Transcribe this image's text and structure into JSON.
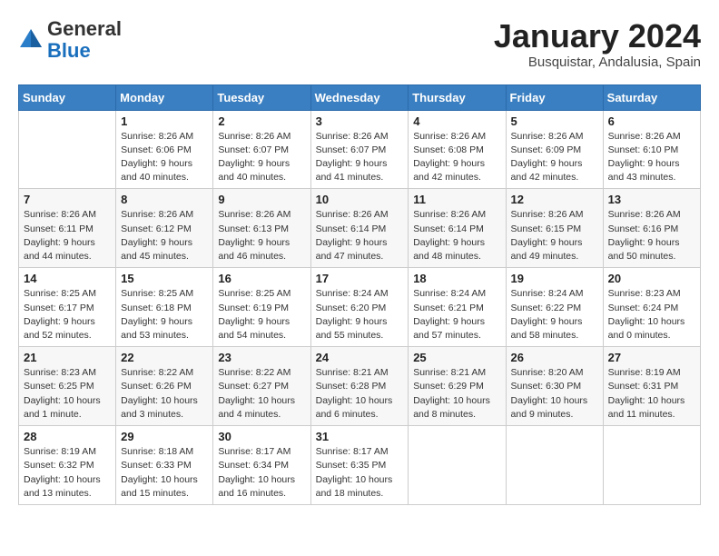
{
  "logo": {
    "general": "General",
    "blue": "Blue"
  },
  "title": "January 2024",
  "subtitle": "Busquistar, Andalusia, Spain",
  "days_of_week": [
    "Sunday",
    "Monday",
    "Tuesday",
    "Wednesday",
    "Thursday",
    "Friday",
    "Saturday"
  ],
  "weeks": [
    [
      {
        "day": "",
        "info": ""
      },
      {
        "day": "1",
        "info": "Sunrise: 8:26 AM\nSunset: 6:06 PM\nDaylight: 9 hours\nand 40 minutes."
      },
      {
        "day": "2",
        "info": "Sunrise: 8:26 AM\nSunset: 6:07 PM\nDaylight: 9 hours\nand 40 minutes."
      },
      {
        "day": "3",
        "info": "Sunrise: 8:26 AM\nSunset: 6:07 PM\nDaylight: 9 hours\nand 41 minutes."
      },
      {
        "day": "4",
        "info": "Sunrise: 8:26 AM\nSunset: 6:08 PM\nDaylight: 9 hours\nand 42 minutes."
      },
      {
        "day": "5",
        "info": "Sunrise: 8:26 AM\nSunset: 6:09 PM\nDaylight: 9 hours\nand 42 minutes."
      },
      {
        "day": "6",
        "info": "Sunrise: 8:26 AM\nSunset: 6:10 PM\nDaylight: 9 hours\nand 43 minutes."
      }
    ],
    [
      {
        "day": "7",
        "info": "Sunrise: 8:26 AM\nSunset: 6:11 PM\nDaylight: 9 hours\nand 44 minutes."
      },
      {
        "day": "8",
        "info": "Sunrise: 8:26 AM\nSunset: 6:12 PM\nDaylight: 9 hours\nand 45 minutes."
      },
      {
        "day": "9",
        "info": "Sunrise: 8:26 AM\nSunset: 6:13 PM\nDaylight: 9 hours\nand 46 minutes."
      },
      {
        "day": "10",
        "info": "Sunrise: 8:26 AM\nSunset: 6:14 PM\nDaylight: 9 hours\nand 47 minutes."
      },
      {
        "day": "11",
        "info": "Sunrise: 8:26 AM\nSunset: 6:14 PM\nDaylight: 9 hours\nand 48 minutes."
      },
      {
        "day": "12",
        "info": "Sunrise: 8:26 AM\nSunset: 6:15 PM\nDaylight: 9 hours\nand 49 minutes."
      },
      {
        "day": "13",
        "info": "Sunrise: 8:26 AM\nSunset: 6:16 PM\nDaylight: 9 hours\nand 50 minutes."
      }
    ],
    [
      {
        "day": "14",
        "info": "Sunrise: 8:25 AM\nSunset: 6:17 PM\nDaylight: 9 hours\nand 52 minutes."
      },
      {
        "day": "15",
        "info": "Sunrise: 8:25 AM\nSunset: 6:18 PM\nDaylight: 9 hours\nand 53 minutes."
      },
      {
        "day": "16",
        "info": "Sunrise: 8:25 AM\nSunset: 6:19 PM\nDaylight: 9 hours\nand 54 minutes."
      },
      {
        "day": "17",
        "info": "Sunrise: 8:24 AM\nSunset: 6:20 PM\nDaylight: 9 hours\nand 55 minutes."
      },
      {
        "day": "18",
        "info": "Sunrise: 8:24 AM\nSunset: 6:21 PM\nDaylight: 9 hours\nand 57 minutes."
      },
      {
        "day": "19",
        "info": "Sunrise: 8:24 AM\nSunset: 6:22 PM\nDaylight: 9 hours\nand 58 minutes."
      },
      {
        "day": "20",
        "info": "Sunrise: 8:23 AM\nSunset: 6:24 PM\nDaylight: 10 hours\nand 0 minutes."
      }
    ],
    [
      {
        "day": "21",
        "info": "Sunrise: 8:23 AM\nSunset: 6:25 PM\nDaylight: 10 hours\nand 1 minute."
      },
      {
        "day": "22",
        "info": "Sunrise: 8:22 AM\nSunset: 6:26 PM\nDaylight: 10 hours\nand 3 minutes."
      },
      {
        "day": "23",
        "info": "Sunrise: 8:22 AM\nSunset: 6:27 PM\nDaylight: 10 hours\nand 4 minutes."
      },
      {
        "day": "24",
        "info": "Sunrise: 8:21 AM\nSunset: 6:28 PM\nDaylight: 10 hours\nand 6 minutes."
      },
      {
        "day": "25",
        "info": "Sunrise: 8:21 AM\nSunset: 6:29 PM\nDaylight: 10 hours\nand 8 minutes."
      },
      {
        "day": "26",
        "info": "Sunrise: 8:20 AM\nSunset: 6:30 PM\nDaylight: 10 hours\nand 9 minutes."
      },
      {
        "day": "27",
        "info": "Sunrise: 8:19 AM\nSunset: 6:31 PM\nDaylight: 10 hours\nand 11 minutes."
      }
    ],
    [
      {
        "day": "28",
        "info": "Sunrise: 8:19 AM\nSunset: 6:32 PM\nDaylight: 10 hours\nand 13 minutes."
      },
      {
        "day": "29",
        "info": "Sunrise: 8:18 AM\nSunset: 6:33 PM\nDaylight: 10 hours\nand 15 minutes."
      },
      {
        "day": "30",
        "info": "Sunrise: 8:17 AM\nSunset: 6:34 PM\nDaylight: 10 hours\nand 16 minutes."
      },
      {
        "day": "31",
        "info": "Sunrise: 8:17 AM\nSunset: 6:35 PM\nDaylight: 10 hours\nand 18 minutes."
      },
      {
        "day": "",
        "info": ""
      },
      {
        "day": "",
        "info": ""
      },
      {
        "day": "",
        "info": ""
      }
    ]
  ]
}
